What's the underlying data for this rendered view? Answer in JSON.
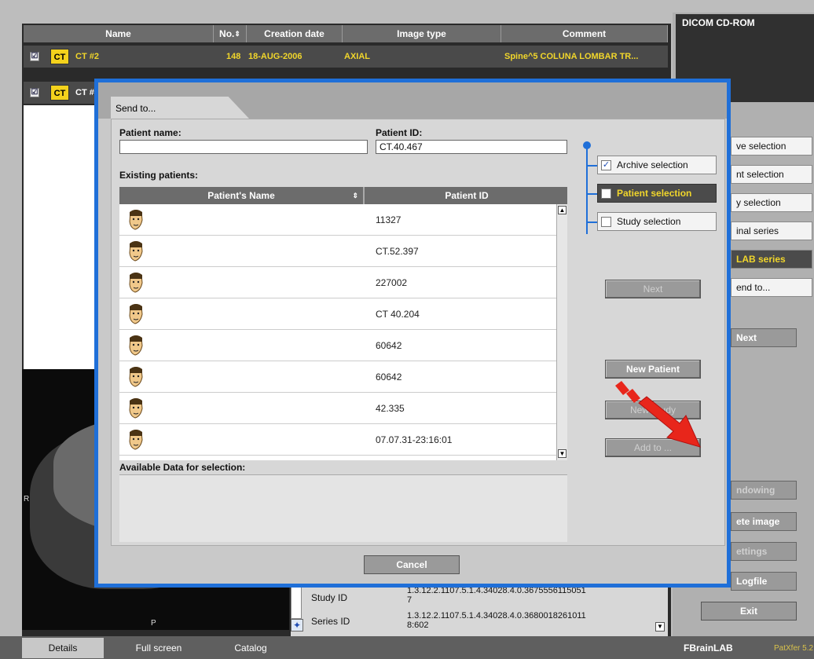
{
  "series_table": {
    "columns": [
      "Name",
      "No.",
      "Creation date",
      "Image type",
      "Comment"
    ],
    "rows": [
      {
        "checked": "☑",
        "modality": "CT",
        "name": "CT #2",
        "no": "148",
        "date": "18-AUG-2006",
        "type": "AXIAL",
        "comment": "Spine^5 COLUNA LOMBAR TR..."
      },
      {
        "checked": "☑",
        "modality": "CT",
        "name": "CT #"
      }
    ]
  },
  "right_panel": {
    "title": "DICOM CD-ROM",
    "buttons": [
      "ve selection",
      "nt selection",
      "y selection",
      "inal series",
      "LAB series",
      "end to...",
      "Next",
      "ndowing",
      "ete image",
      "ettings",
      "Logfile"
    ],
    "exit": "Exit"
  },
  "viewer": {
    "left_marker": "R",
    "bottom_marker": "P"
  },
  "info": {
    "study_label": "Study ID",
    "study_value": "1.3.12.2.1107.5.1.4.34028.4.0.3675556115051\n7",
    "series_label": "Series ID",
    "series_value": "1.3.12.2.1107.5.1.4.34028.4.0.3680018261011\n8:602"
  },
  "bottom_tabs": [
    "Details",
    "Full screen",
    "Catalog"
  ],
  "brand": {
    "name": "BrainLAB",
    "sub": "PatXfer 5.2"
  },
  "dialog": {
    "tab": "Send to...",
    "patient_name_label": "Patient name:",
    "patient_name_value": "",
    "patient_id_label": "Patient ID:",
    "patient_id_value": "CT.40.467",
    "existing_label": "Existing patients:",
    "table_headers": [
      "Patient's Name",
      "Patient ID"
    ],
    "patients": [
      {
        "name": "",
        "id": "11327"
      },
      {
        "name": "",
        "id": "CT.52.397"
      },
      {
        "name": "",
        "id": "227002"
      },
      {
        "name": "",
        "id": "CT 40.204"
      },
      {
        "name": "",
        "id": "60642"
      },
      {
        "name": "",
        "id": "60642"
      },
      {
        "name": "",
        "id": "42.335"
      },
      {
        "name": "",
        "id": "07.07.31-23:16:01"
      }
    ],
    "available_label": "Available Data for selection:",
    "steps": [
      {
        "label": "Archive selection",
        "mark": "✓"
      },
      {
        "label": "Patient selection",
        "mark": ""
      },
      {
        "label": "Study selection",
        "mark": ""
      }
    ],
    "buttons": {
      "next": "Next",
      "new_patient": "New Patient",
      "new_study": "New Study",
      "add_to": "Add to ..."
    },
    "cancel": "Cancel"
  },
  "colors": {
    "accent_blue": "#1f6fd8",
    "highlight_yellow": "#f1d62b",
    "arrow_red": "#e8261b"
  }
}
